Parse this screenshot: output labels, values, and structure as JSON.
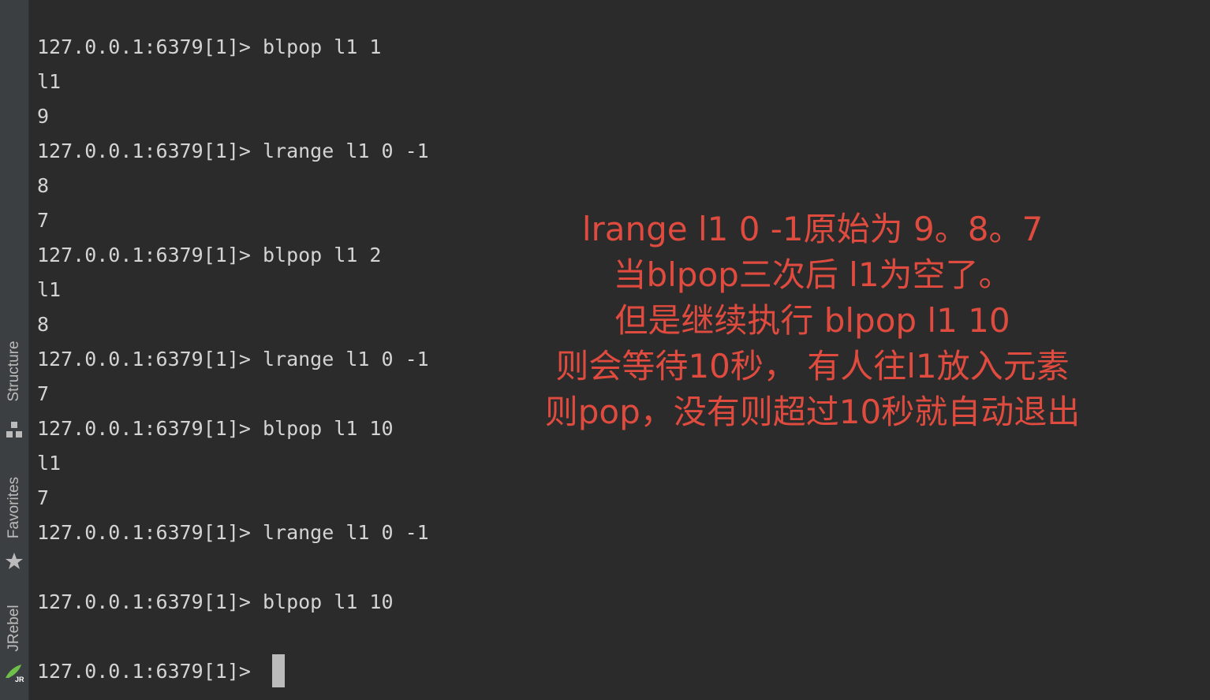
{
  "sidebar": {
    "tabs": [
      {
        "label": "Structure",
        "icon": "structure-icon"
      },
      {
        "label": "Favorites",
        "icon": "star-icon"
      },
      {
        "label": "JRebel",
        "icon": "jrebel-icon"
      }
    ]
  },
  "terminal": {
    "lines": [
      "127.0.0.1:6379[1]> blpop l1 1",
      "l1",
      "9",
      "127.0.0.1:6379[1]> lrange l1 0 -1",
      "8",
      "7",
      "127.0.0.1:6379[1]> blpop l1 2",
      "l1",
      "8",
      "127.0.0.1:6379[1]> lrange l1 0 -1",
      "7",
      "127.0.0.1:6379[1]> blpop l1 10",
      "l1",
      "7",
      "127.0.0.1:6379[1]> lrange l1 0 -1",
      "",
      "127.0.0.1:6379[1]> blpop l1 10",
      ""
    ],
    "prompt": "127.0.0.1:6379[1]> "
  },
  "annotation": {
    "lines": [
      "lrange l1 0 -1原始为 9。8。7",
      "当blpop三次后 l1为空了。",
      "但是继续执行 blpop l1 10",
      "则会等待10秒， 有人往l1放入元素",
      "则pop，没有则超过10秒就自动退出"
    ]
  },
  "colors": {
    "background": "#2b2b2b",
    "sidebar": "#3c3f41",
    "terminal_text": "#d4d4d4",
    "annotation_text": "#e04b3f",
    "cursor": "#bbbbbb"
  }
}
